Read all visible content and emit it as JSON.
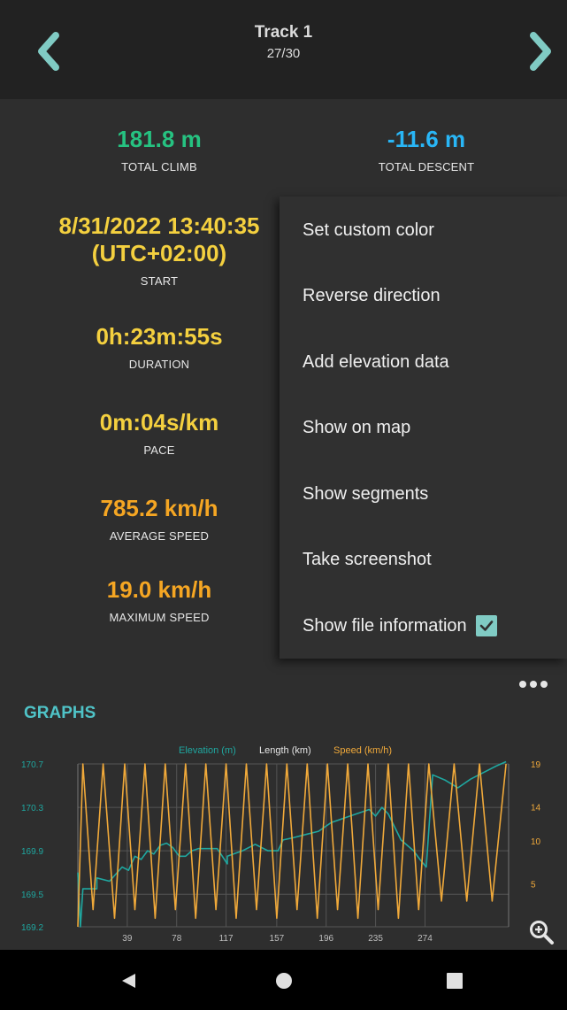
{
  "header": {
    "title": "Track 1",
    "subtitle": "27/30"
  },
  "stats": {
    "total_climb": {
      "value": "181.8 m",
      "label": "TOTAL CLIMB"
    },
    "total_descent": {
      "value": "-11.6 m",
      "label": "TOTAL DESCENT"
    },
    "start": {
      "value_line1": "8/31/2022 13:40:35",
      "value_line2": "(UTC+02:00)",
      "label": "START"
    },
    "duration": {
      "value": "0h:23m:55s",
      "label": "DURATION"
    },
    "pace": {
      "value": "0m:04s/km",
      "label": "PACE"
    },
    "average_speed": {
      "value": "785.2 km/h",
      "label": "AVERAGE SPEED"
    },
    "maximum_speed": {
      "value": "19.0 km/h",
      "label": "MAXIMUM SPEED"
    }
  },
  "menu": {
    "items": [
      {
        "label": "Set custom color"
      },
      {
        "label": "Reverse direction"
      },
      {
        "label": "Add elevation data"
      },
      {
        "label": "Show on map"
      },
      {
        "label": "Show segments"
      },
      {
        "label": "Take screenshot"
      },
      {
        "label": "Show file information",
        "checked": true
      }
    ]
  },
  "graphs": {
    "title": "GRAPHS",
    "legend": {
      "elevation": "Elevation (m)",
      "length": "Length (km)",
      "speed": "Speed (km/h)"
    }
  },
  "colors": {
    "accent_teal": "#4fc3c7",
    "elevation": "#1fa7a0",
    "speed": "#f0a93a",
    "green": "#26c281",
    "blue": "#29b6f6",
    "yellow": "#f4d03f",
    "orange": "#f5a623"
  },
  "icons": {
    "prev": "chevron-left-icon",
    "next": "chevron-right-icon",
    "more": "more-horizontal-icon",
    "zoom": "zoom-in-icon",
    "back": "nav-back-icon",
    "home": "nav-home-icon",
    "recents": "nav-recents-icon"
  },
  "chart_data": {
    "type": "line",
    "title": "",
    "xlabel": "",
    "x_ticks": [
      "39",
      "78",
      "117",
      "157",
      "196",
      "235",
      "274"
    ],
    "xlim": [
      0,
      340
    ],
    "y_left_ticks": [
      "170.7",
      "170.3",
      "169.9",
      "169.5",
      "169.2"
    ],
    "y_left_lim": [
      169.2,
      170.7
    ],
    "y_right_ticks": [
      "19",
      "14",
      "10",
      "5"
    ],
    "y_right_lim": [
      0,
      19
    ],
    "grid": true,
    "legend_position": "top",
    "series": [
      {
        "name": "Elevation (m)",
        "axis": "left",
        "x": [
          0,
          2,
          4,
          15,
          15,
          25,
          35,
          40,
          45,
          50,
          55,
          60,
          65,
          70,
          75,
          80,
          85,
          88,
          90,
          95,
          100,
          105,
          110,
          118,
          118,
          125,
          130,
          140,
          150,
          158,
          162,
          170,
          180,
          190,
          200,
          210,
          220,
          230,
          235,
          240,
          245,
          255,
          265,
          270,
          275,
          280,
          290,
          300,
          310,
          320,
          330,
          338
        ],
        "y": [
          169.7,
          169.2,
          169.55,
          169.55,
          169.65,
          169.62,
          169.75,
          169.72,
          169.85,
          169.82,
          169.9,
          169.87,
          169.95,
          169.97,
          169.93,
          169.85,
          169.85,
          169.88,
          169.9,
          169.92,
          169.92,
          169.92,
          169.92,
          169.78,
          169.85,
          169.88,
          169.9,
          169.96,
          169.9,
          169.9,
          170.0,
          170.02,
          170.05,
          170.08,
          170.16,
          170.2,
          170.24,
          170.28,
          170.22,
          170.3,
          170.24,
          170.0,
          169.9,
          169.82,
          169.75,
          170.6,
          170.55,
          170.48,
          170.56,
          170.62,
          170.68,
          170.72
        ]
      },
      {
        "name": "Speed (km/h)",
        "axis": "right",
        "x": [
          0,
          4,
          12,
          20,
          29,
          37,
          45,
          53,
          61,
          69,
          77,
          85,
          93,
          101,
          109,
          117,
          125,
          133,
          141,
          149,
          157,
          165,
          173,
          181,
          189,
          197,
          205,
          213,
          221,
          229,
          237,
          245,
          253,
          261,
          269,
          277,
          287,
          297,
          307,
          317,
          327,
          338
        ],
        "y": [
          0,
          19,
          2,
          19,
          1,
          19,
          2,
          19,
          1,
          19,
          2,
          19,
          1,
          19,
          2,
          19,
          1,
          19,
          2,
          19,
          1,
          19,
          2,
          19,
          1,
          19,
          2,
          19,
          1,
          19,
          2,
          19,
          1,
          19,
          2,
          19,
          3,
          19,
          3,
          19,
          3,
          19
        ]
      }
    ]
  }
}
